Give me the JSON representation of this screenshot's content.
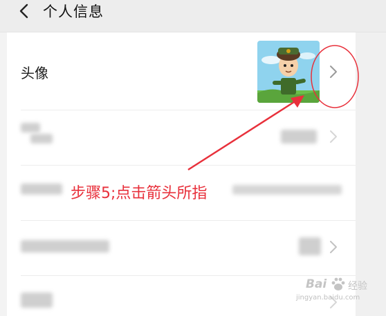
{
  "header": {
    "title": "个人信息",
    "back_icon": "chevron-left-icon"
  },
  "rows": [
    {
      "label": "头像",
      "value_kind": "avatar-image",
      "chevron_icon": "chevron-right-icon"
    },
    {
      "label": "",
      "value_kind": "blurred"
    },
    {
      "label": "",
      "value_kind": "blurred"
    },
    {
      "label": "",
      "value_kind": "blurred"
    },
    {
      "label": "",
      "value_kind": "blurred"
    }
  ],
  "annotation": {
    "text": "步骤5;点击箭头所指",
    "color": "#e8303b",
    "shapes": [
      "red-ellipse",
      "red-arrow"
    ]
  },
  "watermark": {
    "brand": "Bai",
    "suffix": "经验",
    "url": "jingyan.baidu.com"
  },
  "colors": {
    "header_bg": "#ededed",
    "panel_bg": "#ffffff",
    "accent_red": "#e8303b"
  }
}
